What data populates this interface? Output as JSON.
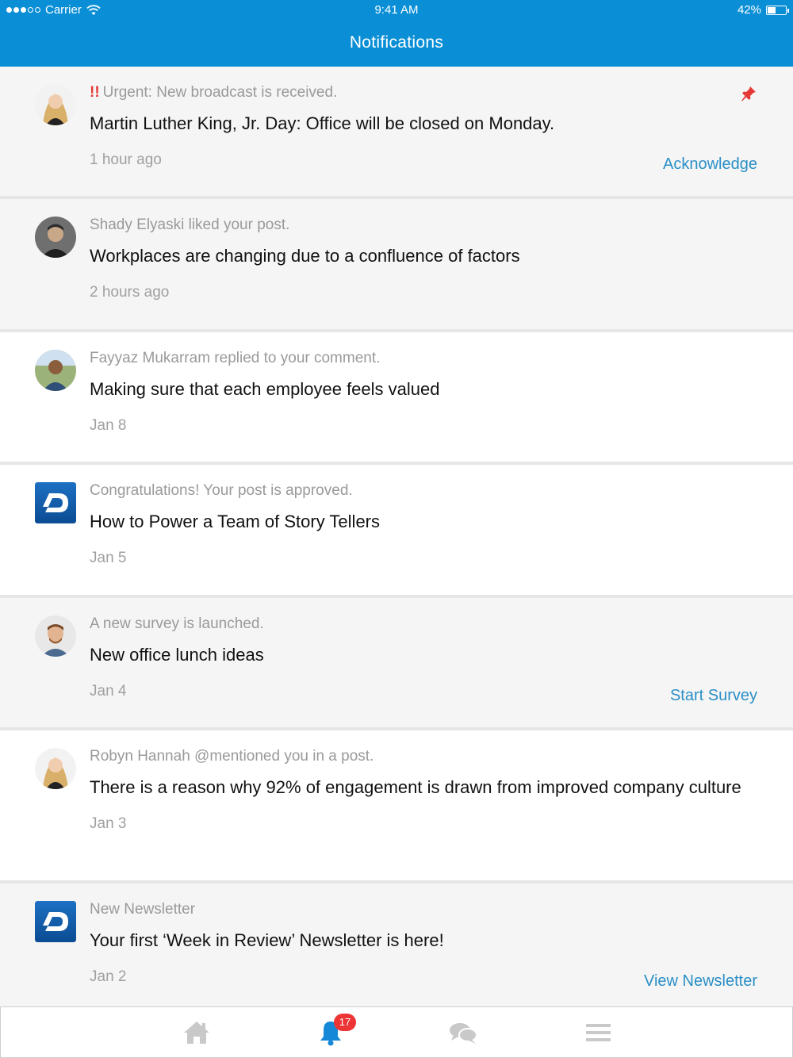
{
  "status_bar": {
    "carrier": "Carrier",
    "time": "9:41 AM",
    "battery": "42%"
  },
  "nav": {
    "title": "Notifications"
  },
  "notifications": [
    {
      "meta_prefix": "!!",
      "meta": "Urgent: New broadcast is received.",
      "title": "Martin Luther King, Jr. Day: Office will be closed on Monday.",
      "time": "1 hour ago",
      "action": "Acknowledge"
    },
    {
      "meta": "Shady Elyaski liked your post.",
      "title": "Workplaces are changing due to a confluence of factors",
      "time": "2 hours ago"
    },
    {
      "meta": "Fayyaz Mukarram replied to your comment.",
      "title": "Making sure that each employee feels valued",
      "time": "Jan 8"
    },
    {
      "meta": "Congratulations! Your post is approved.",
      "title": "How to Power a Team of Story Tellers",
      "time": "Jan 5"
    },
    {
      "meta": "A new survey is launched.",
      "title": "New office lunch ideas",
      "time": "Jan 4",
      "action": "Start Survey"
    },
    {
      "meta": "Robyn Hannah @mentioned you in a post.",
      "title": "There is a reason why 92% of engagement is drawn from improved company culture",
      "time": "Jan 3"
    },
    {
      "meta": "New Newsletter",
      "title": "Your first ‘Week in Review’ Newsletter is here!",
      "time": "Jan 2",
      "action": "View Newsletter"
    }
  ],
  "tab_bar": {
    "notifications_badge": "17",
    "icons": [
      "home-icon",
      "bell-icon",
      "chat-icon",
      "menu-icon"
    ]
  },
  "colors": {
    "nav_bar": "#0a8fd6",
    "action_link": "#2a8fc6",
    "urgent": "#e53935",
    "badge": "#ee3535",
    "active_tab": "#1589d8",
    "inactive_tab": "#c9c9c9"
  }
}
